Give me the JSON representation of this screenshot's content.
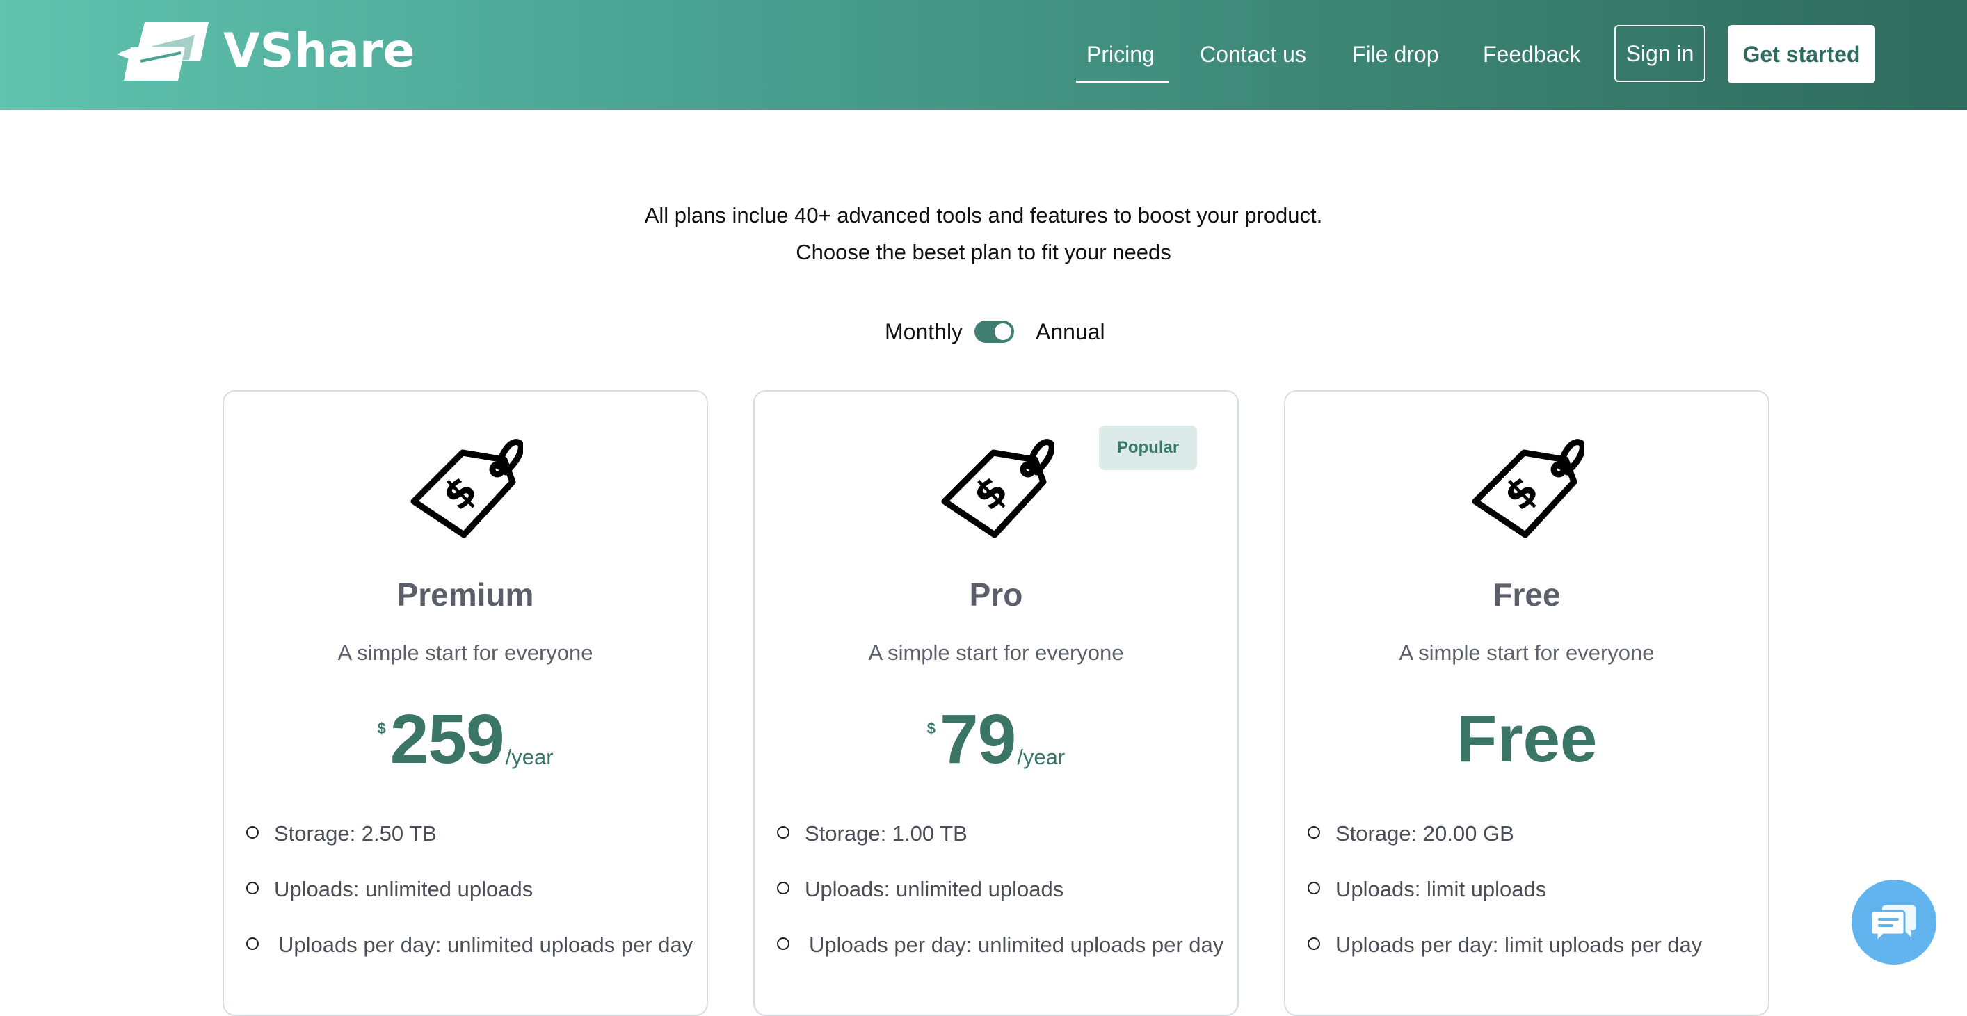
{
  "brand": {
    "name": "VShare",
    "logo_icon": "vshare-logo-icon"
  },
  "nav": {
    "links": [
      {
        "label": "Pricing",
        "active": true
      },
      {
        "label": "Contact us",
        "active": false
      },
      {
        "label": "File drop",
        "active": false
      },
      {
        "label": "Feedback",
        "active": false
      }
    ],
    "sign_in_label": "Sign in",
    "get_started_label": "Get started"
  },
  "intro": {
    "line1": "All plans inclue 40+ advanced tools and features to boost your product.",
    "line2": "Choose the beset plan to fit your needs"
  },
  "billing": {
    "monthly_label": "Monthly",
    "annual_label": "Annual",
    "annual_selected": true
  },
  "plans": [
    {
      "icon": "price-tag-icon",
      "name": "Premium",
      "description": "A simple start for everyone",
      "currency": "$",
      "price": "259",
      "period": "/year",
      "features": [
        "Storage: 2.50 TB",
        "Uploads: unlimited uploads",
        "Uploads per day: unlimited uploads per day"
      ]
    },
    {
      "icon": "price-tag-icon",
      "badge": "Popular",
      "name": "Pro",
      "description": "A simple start for everyone",
      "currency": "$",
      "price": "79",
      "period": "/year",
      "features": [
        "Storage: 1.00 TB",
        "Uploads: unlimited uploads",
        "Uploads per day: unlimited uploads per day"
      ]
    },
    {
      "icon": "price-tag-icon",
      "name": "Free",
      "description": "A simple start for everyone",
      "price_text": "Free",
      "features": [
        "Storage: 20.00 GB",
        "Uploads: limit uploads",
        "Uploads per day: limit uploads per day"
      ]
    }
  ],
  "chat": {
    "icon": "chat-bubbles-icon"
  },
  "colors": {
    "header_gradient_start": "#5fc3ae",
    "header_gradient_end": "#2f6b5e",
    "accent": "#3a7566",
    "badge_bg": "#dcebe7",
    "chat_button": "#62b4ef",
    "card_border": "#d8dde3"
  }
}
